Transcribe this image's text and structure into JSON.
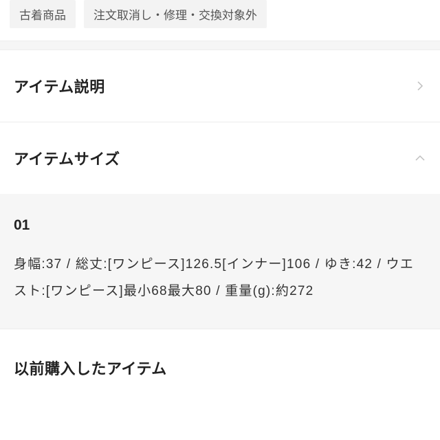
{
  "tags": {
    "used": "古着商品",
    "nocancel": "注文取消し・修理・交換対象外"
  },
  "sections": {
    "description": {
      "title": "アイテム説明"
    },
    "size": {
      "title": "アイテムサイズ",
      "label": "01",
      "body": "身幅:37 / 総丈:[ワンピース]126.5[インナー]106 / ゆき:42 / ウエスト:[ワンピース]最小68最大80 / 重量(g):約272"
    },
    "previous": {
      "title": "以前購入したアイテム"
    }
  }
}
